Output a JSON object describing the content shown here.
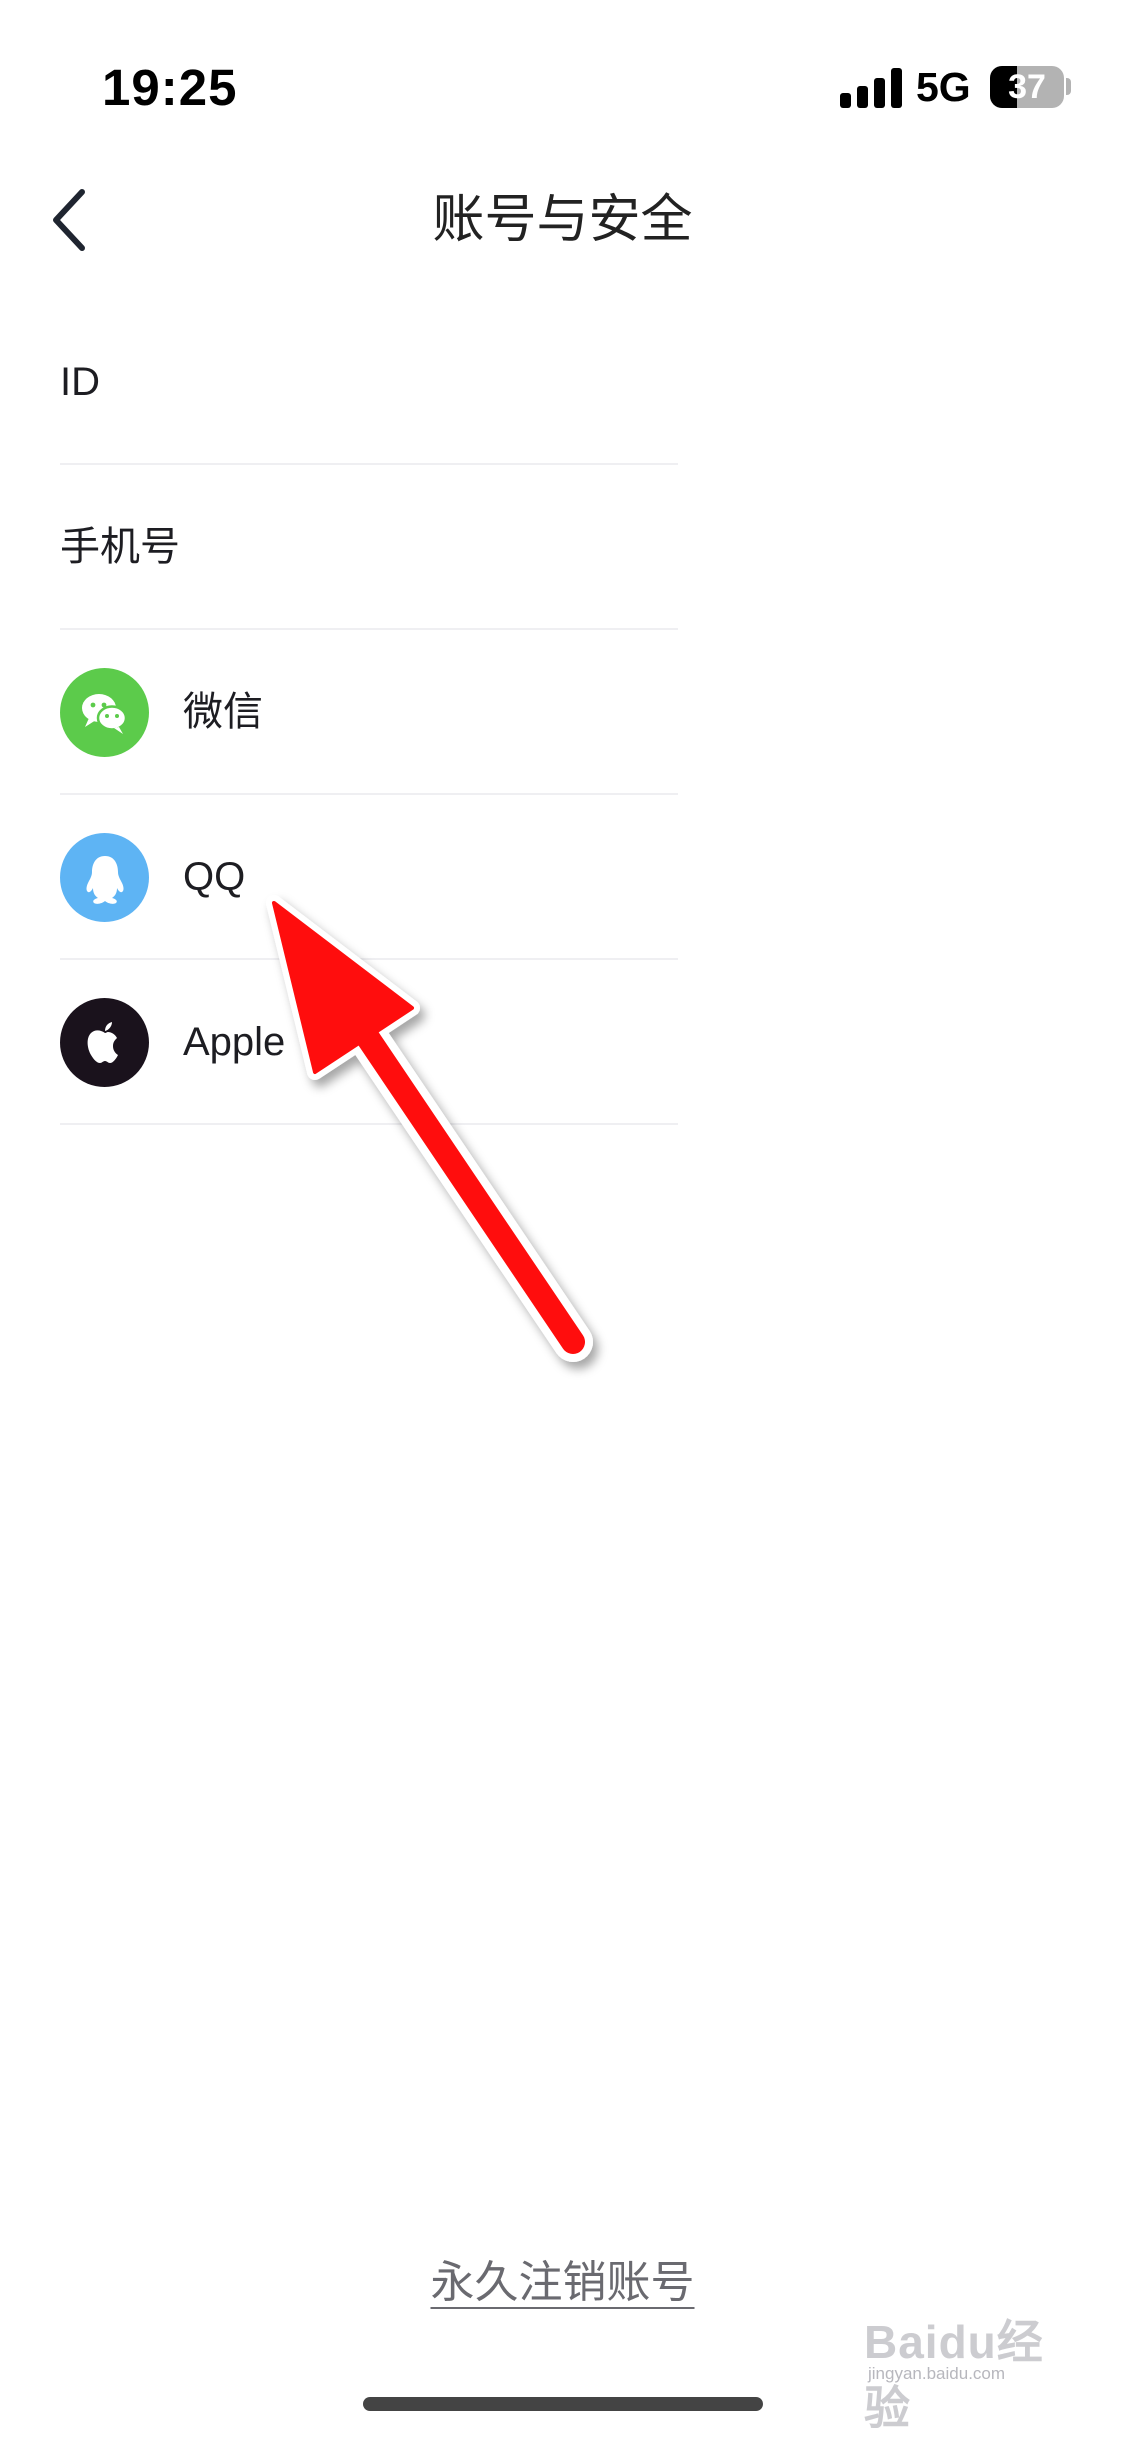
{
  "status_bar": {
    "time": "19:25",
    "network": "5G",
    "battery_level": "37",
    "battery_fraction": 0.37
  },
  "header": {
    "title": "账号与安全",
    "back_icon": "chevron-left-icon"
  },
  "rows": [
    {
      "label": "ID",
      "value": "",
      "icon": null
    },
    {
      "label": "手机号",
      "value": "",
      "icon": null
    },
    {
      "label": "微信",
      "value": "",
      "icon": "wechat-icon",
      "icon_color": "#5ccb4b"
    },
    {
      "label": "QQ",
      "value": "",
      "icon": "qq-penguin-icon",
      "icon_color": "#5eb4f4"
    },
    {
      "label": "Apple",
      "value": "",
      "icon": "apple-icon",
      "icon_color": "#1a121c"
    }
  ],
  "footer": {
    "deactivate_label": "永久注销账号"
  },
  "watermark": {
    "brand": "Baidu经验",
    "url": "jingyan.baidu.com"
  },
  "colors": {
    "annotation_arrow": "#ff0a0a",
    "divider": "#efeff2"
  }
}
